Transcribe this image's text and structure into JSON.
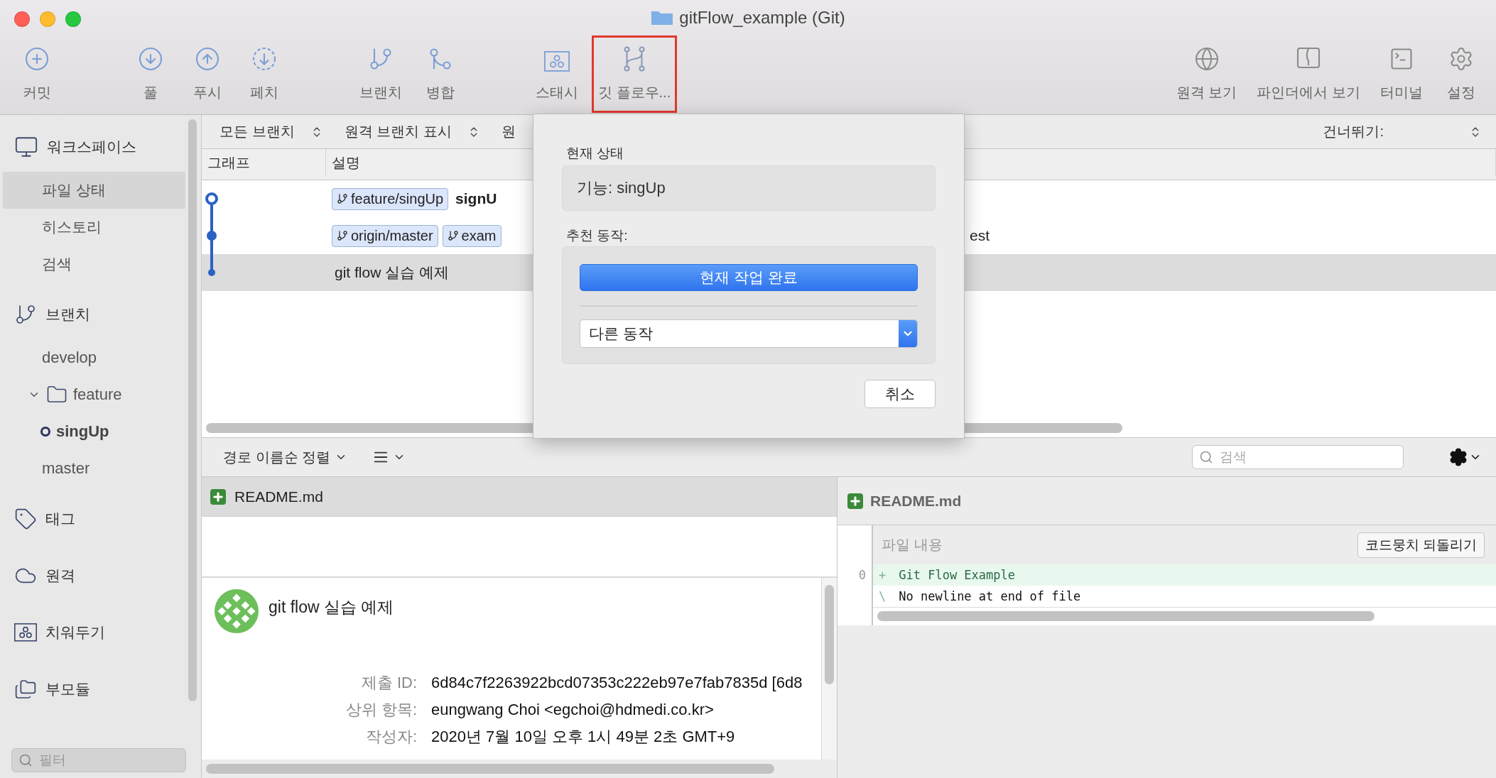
{
  "window": {
    "title": "gitFlow_example (Git)"
  },
  "toolbar": {
    "left_groups": [
      [
        {
          "label": "커밋",
          "kind": "commit",
          "highlighted": false
        }
      ],
      [
        {
          "label": "풀",
          "kind": "pull",
          "highlighted": false
        },
        {
          "label": "푸시",
          "kind": "push",
          "highlighted": false
        },
        {
          "label": "페치",
          "kind": "fetch",
          "highlighted": false
        }
      ],
      [
        {
          "label": "브랜치",
          "kind": "branch",
          "highlighted": false
        },
        {
          "label": "병합",
          "kind": "merge",
          "highlighted": false
        }
      ],
      [
        {
          "label": "스태시",
          "kind": "stash",
          "highlighted": false
        },
        {
          "label": "깃 플로우...",
          "kind": "flow",
          "highlighted": true
        }
      ]
    ],
    "right_items": [
      {
        "label": "원격 보기",
        "kind": "globe",
        "highlighted": false
      },
      {
        "label": "파인더에서 보기",
        "kind": "window",
        "highlighted": false
      },
      {
        "label": "터미널",
        "kind": "terminal",
        "highlighted": false
      },
      {
        "label": "설정",
        "kind": "settings",
        "highlighted": false
      }
    ]
  },
  "sidebar": {
    "sections": [
      {
        "label": "워크스페이스",
        "kind": "monitor",
        "items": [
          {
            "label": "파일 상태",
            "kind": "view",
            "selected": true
          },
          {
            "label": "히스토리",
            "kind": "view",
            "selected": false
          },
          {
            "label": "검색",
            "kind": "view",
            "selected": false
          }
        ]
      },
      {
        "label": "브랜치",
        "kind": "branch",
        "items": [
          {
            "label": "develop",
            "kind": "branch",
            "current": false
          },
          {
            "label": "feature",
            "kind": "folder",
            "expanded": true,
            "children": [
              {
                "label": "singUp",
                "kind": "branch",
                "current": true
              }
            ]
          },
          {
            "label": "master",
            "kind": "branch",
            "current": false
          }
        ]
      },
      {
        "label": "태그",
        "kind": "tag"
      },
      {
        "label": "원격",
        "kind": "cloud"
      },
      {
        "label": "치워두기",
        "kind": "stash"
      },
      {
        "label": "부모듈",
        "kind": "submodule"
      }
    ],
    "filter": {
      "placeholder": "필터"
    }
  },
  "branch_bar": {
    "filters": [
      {
        "label": "모든 브랜치",
        "has_stepper": true
      },
      {
        "label": "원격 브랜치 표시",
        "has_stepper": true
      },
      {
        "label": "원",
        "has_stepper": false
      }
    ],
    "skip_label": "건너뛰기:"
  },
  "commits": {
    "columns": [
      "그래프",
      "설명"
    ],
    "rows": [
      {
        "kind": "head",
        "tags": [
          "feature/singUp"
        ],
        "message": "signU",
        "bold": true,
        "selected": false
      },
      {
        "kind": "commit",
        "tags": [
          "origin/master",
          "exam"
        ],
        "trailing": "est",
        "selected": false
      },
      {
        "kind": "end",
        "message": "git flow 실습 예제",
        "bold": false,
        "selected": true
      }
    ]
  },
  "git_flow_popover": {
    "status_label": "현재 상태",
    "status": "기능: singUp",
    "actions_label": "추천 동작:",
    "primary_action": "현재 작업 완료",
    "other_action": "다른 동작",
    "cancel": "취소"
  },
  "file_list": {
    "sort": "경로 이름순 정렬",
    "files": [
      {
        "name": "README.md",
        "kind": "added",
        "selected": true
      }
    ]
  },
  "commit_detail": {
    "message": "git flow 실습 예제",
    "fields": [
      {
        "label": "제출 ID:",
        "value": "6d84c7f2263922bcd07353c222eb97e7fab7835d [6d8"
      },
      {
        "label": "상위 항목:",
        "value": "eungwang Choi <egchoi@hdmedi.co.kr>"
      },
      {
        "label": "작성자:",
        "value": "2020년 7월 10일 오후 1시 49분 2초 GMT+9"
      }
    ]
  },
  "diff": {
    "search_placeholder": "검색",
    "file": {
      "name": "README.md",
      "kind": "added"
    },
    "hunk": {
      "title": "파일 내용",
      "revert": "코드뭉치 되돌리기",
      "lines": [
        {
          "number": "0",
          "prefix": "+",
          "text": "Git Flow Example",
          "kind": "added"
        },
        {
          "prefix": "\\",
          "text": "No newline at end of file",
          "kind": "context"
        }
      ]
    }
  }
}
